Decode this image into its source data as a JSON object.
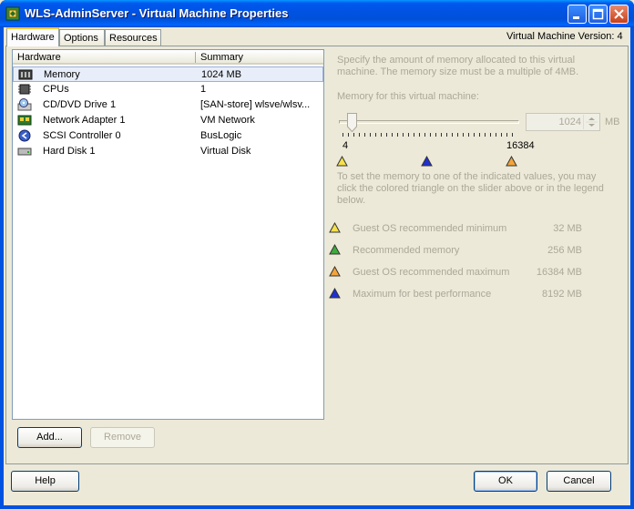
{
  "window": {
    "title": "WLS-AdminServer - Virtual Machine Properties",
    "version_label": "Virtual Machine Version: 4"
  },
  "tabs": [
    {
      "label": "Hardware",
      "active": true
    },
    {
      "label": "Options",
      "active": false
    },
    {
      "label": "Resources",
      "active": false
    }
  ],
  "hardware_table": {
    "columns": [
      "Hardware",
      "Summary"
    ],
    "rows": [
      {
        "name": "Memory",
        "summary": "1024 MB",
        "icon": "memory-icon",
        "selected": true
      },
      {
        "name": "CPUs",
        "summary": "1",
        "icon": "cpu-icon"
      },
      {
        "name": "CD/DVD Drive 1",
        "summary": "[SAN-store] wlsve/wlsv...",
        "icon": "cd-drive-icon"
      },
      {
        "name": "Network Adapter 1",
        "summary": "VM Network",
        "icon": "network-adapter-icon"
      },
      {
        "name": "SCSI Controller 0",
        "summary": "BusLogic",
        "icon": "scsi-controller-icon"
      },
      {
        "name": "Hard Disk 1",
        "summary": "Virtual Disk",
        "icon": "hard-disk-icon"
      }
    ]
  },
  "memory": {
    "description": "Specify the amount of memory allocated to this virtual machine. The memory size must be a multiple of 4MB.",
    "field_label": "Memory for this virtual machine:",
    "value": "1024",
    "unit": "MB",
    "slider_min_label": "4",
    "slider_max_label": "16384",
    "hint": "To set the memory to one of the indicated values, you may click the colored triangle on the slider above or in the legend below.",
    "legend": [
      {
        "label": "Guest OS recommended minimum",
        "value": "32 MB",
        "color": "#f4e04a"
      },
      {
        "label": "Recommended memory",
        "value": "256 MB",
        "color": "#3cab3c"
      },
      {
        "label": "Guest OS recommended maximum",
        "value": "16384 MB",
        "color": "#f4a43a"
      },
      {
        "label": "Maximum for best performance",
        "value": "8192 MB",
        "color": "#2030d0"
      }
    ]
  },
  "buttons": {
    "add": "Add...",
    "remove": "Remove",
    "help": "Help",
    "ok": "OK",
    "cancel": "Cancel"
  }
}
